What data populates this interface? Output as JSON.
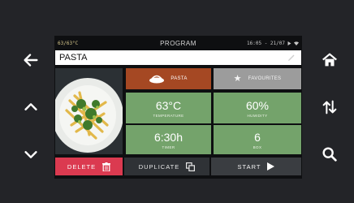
{
  "status": {
    "temp": "63/63°C",
    "title": "PROGRAM",
    "datetime": "16:05 - 21/07"
  },
  "recipe": {
    "name": "PASTA"
  },
  "category": {
    "active": "PASTA",
    "favourites": "FAVOURITES"
  },
  "params": {
    "temperature": {
      "value": "63°C",
      "label": "TEMPERATURE"
    },
    "humidity": {
      "value": "60%",
      "label": "HUMIDITY"
    },
    "timer": {
      "value": "6:30h",
      "label": "TIMER"
    },
    "box": {
      "value": "6",
      "label": "BOX"
    }
  },
  "actions": {
    "delete": "DELETE",
    "duplicate": "DUPLICATE",
    "start": "START"
  },
  "colors": {
    "accent_green": "#74a36b",
    "pasta_category": "#a54823",
    "delete_red": "#db3a50"
  },
  "icons": [
    "back-arrow-icon",
    "home-icon",
    "chevron-up-icon",
    "sort-arrows-icon",
    "chevron-down-icon",
    "search-icon",
    "pencil-icon",
    "pasta-dish-icon",
    "star-icon",
    "trash-icon",
    "duplicate-icon",
    "play-icon",
    "wifi-icon"
  ]
}
